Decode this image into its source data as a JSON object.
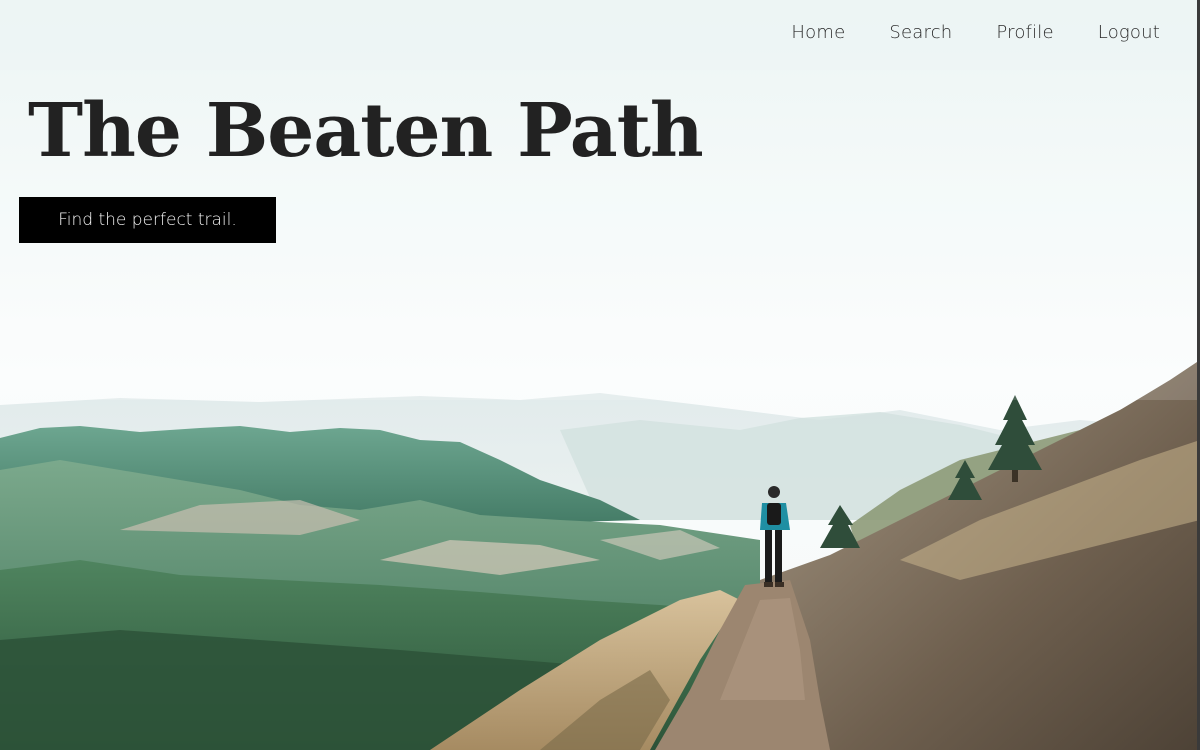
{
  "nav": {
    "home": "Home",
    "search": "Search",
    "profile": "Profile",
    "logout": "Logout"
  },
  "hero": {
    "title": "The Beaten Path",
    "tagline": "Find the perfect trail."
  },
  "colors": {
    "title_text": "#222222",
    "button_bg": "#000000",
    "button_text": "#f4f4f4",
    "sky": "#f6fafa",
    "forest": "#3f7a5f",
    "trail": "#8a7560"
  }
}
